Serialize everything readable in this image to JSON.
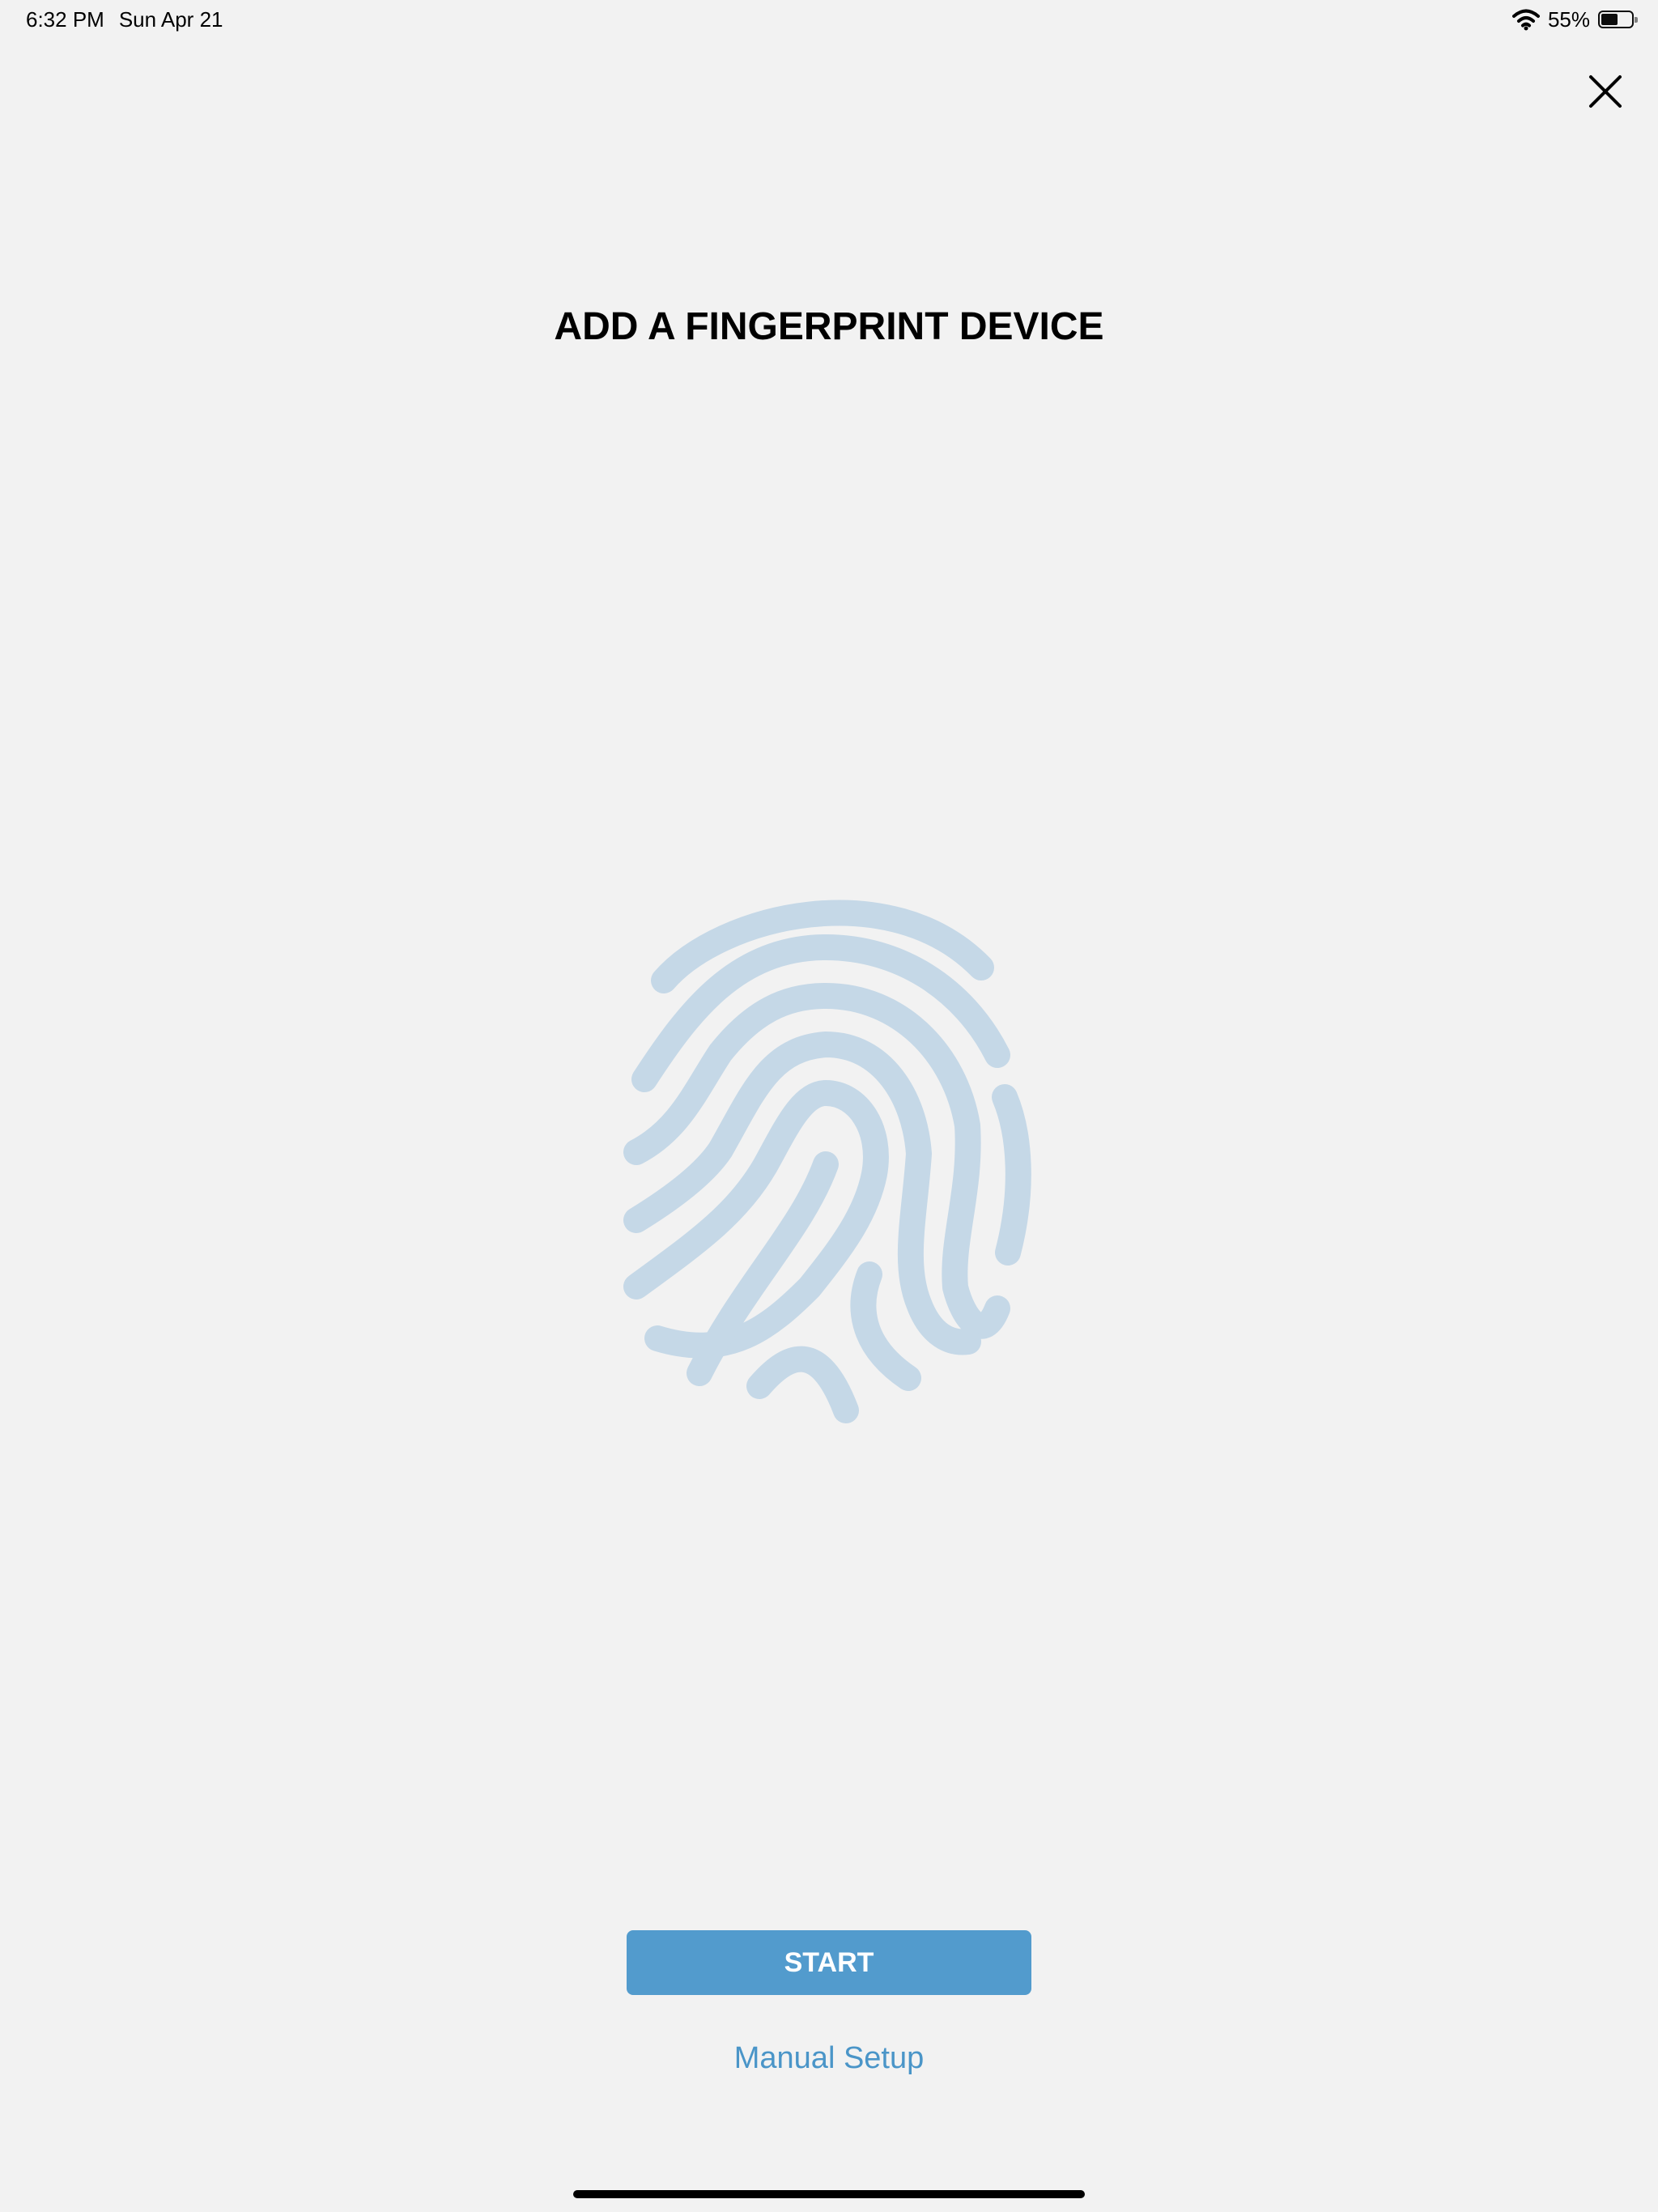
{
  "status_bar": {
    "time": "6:32 PM",
    "date": "Sun Apr 21",
    "battery_percent_label": "55%",
    "battery_level": 0.55
  },
  "header": {
    "close_icon": "close-icon"
  },
  "main": {
    "title": "ADD A FINGERPRINT DEVICE",
    "illustration_icon": "fingerprint-icon",
    "illustration_color": "#c5d8e7"
  },
  "actions": {
    "start_label": "START",
    "manual_setup_label": "Manual Setup",
    "accent_color": "#529bcd"
  }
}
